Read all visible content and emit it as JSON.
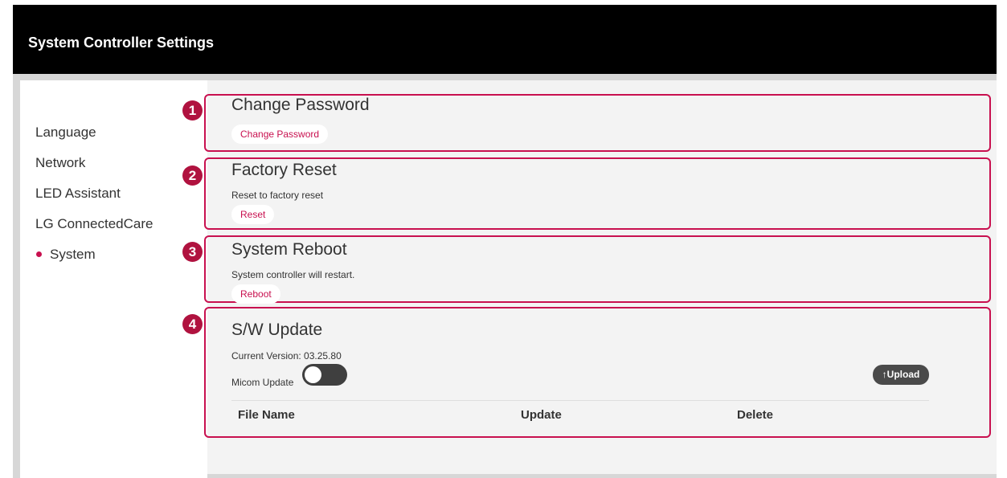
{
  "header": {
    "title": "System Controller Settings"
  },
  "sidebar": {
    "items": [
      {
        "label": "Language"
      },
      {
        "label": "Network"
      },
      {
        "label": "LED Assistant"
      },
      {
        "label": "LG ConnectedCare"
      },
      {
        "label": "System",
        "active": true
      }
    ]
  },
  "sections": {
    "change_password": {
      "badge": "1",
      "title": "Change Password",
      "button": "Change Password"
    },
    "factory_reset": {
      "badge": "2",
      "title": "Factory Reset",
      "description": "Reset to factory reset",
      "button": "Reset"
    },
    "system_reboot": {
      "badge": "3",
      "title": "System Reboot",
      "description": "System controller will restart.",
      "button": "Reboot"
    },
    "sw_update": {
      "badge": "4",
      "title": "S/W Update",
      "current_version": "Current Version: 03.25.80",
      "micom_label": "Micom Update",
      "micom_toggle_on": false,
      "upload_label": "↑Upload",
      "table_headers": [
        "File Name",
        "Update",
        "Delete"
      ]
    }
  },
  "colors": {
    "accent": "#c8104f",
    "header_bg": "#000000",
    "toggle_off": "#3f3f3f"
  }
}
